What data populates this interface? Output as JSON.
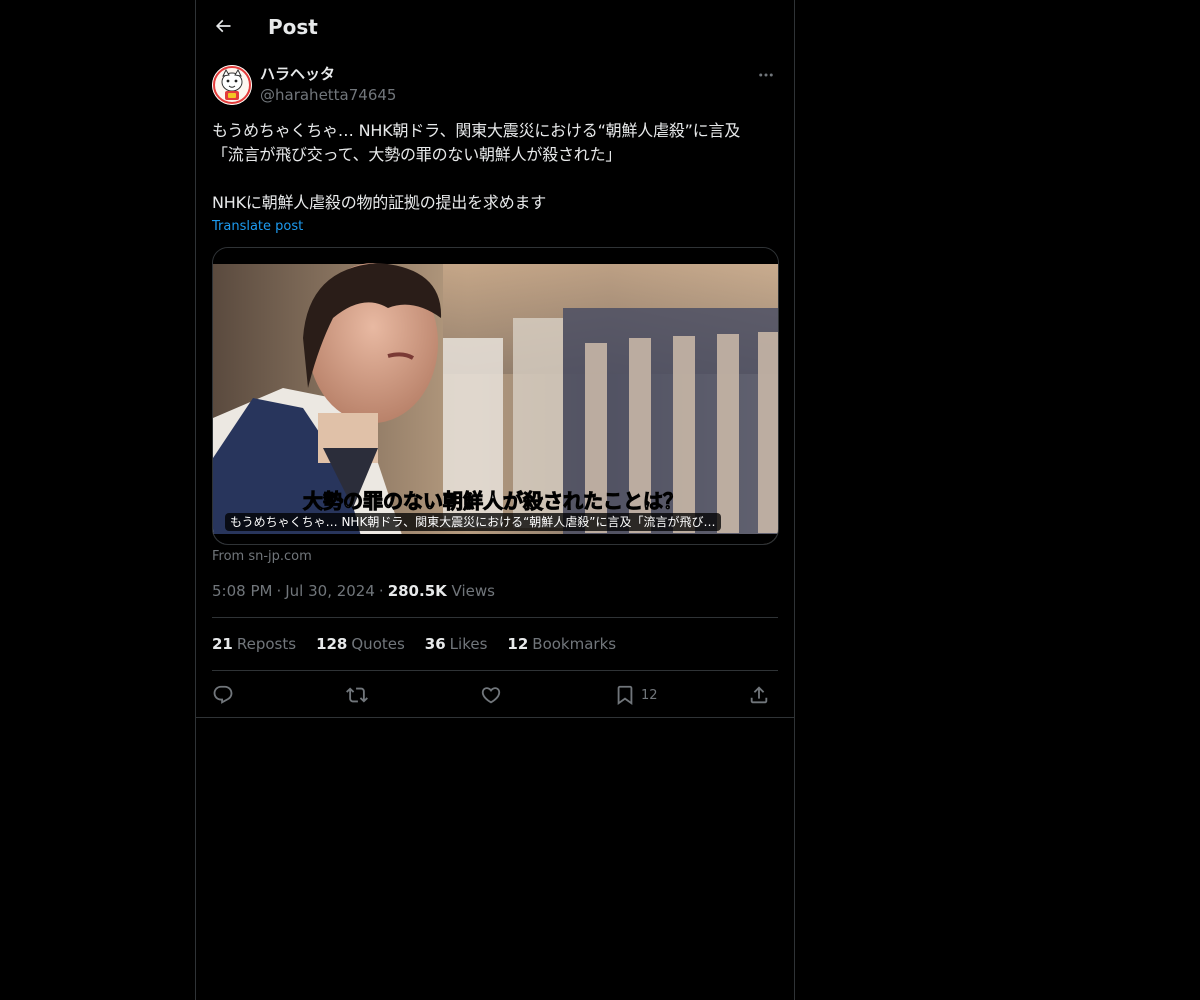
{
  "header": {
    "back_icon": "arrow-left-icon",
    "title": "Post"
  },
  "author": {
    "display_name": "ハラヘッタ",
    "handle": "@harahetta74645",
    "avatar_icon": "cartoon-avatar",
    "more_icon": "more-horizontal-icon"
  },
  "post": {
    "text": "もうめちゃくちゃ… NHK朝ドラ、関東大震災における“朝鮮人虐殺”に言及\n「流言が飛び交って、大勢の罪のない朝鮮人が殺された」\n\nNHKに朝鮮人虐殺の物的証拠の提出を求めます",
    "translate_label": "Translate post"
  },
  "card": {
    "image_subtitle": "大勢の罪のない朝鮮人が殺されたことは？",
    "caption": "もうめちゃくちゃ… NHK朝ドラ、関東大震災における“朝鮮人虐殺”に言及「流言が飛び…",
    "source": "From sn-jp.com"
  },
  "meta": {
    "time": "5:08 PM",
    "date": "Jul 30, 2024",
    "views_count": "280.5K",
    "views_label": "Views"
  },
  "stats": [
    {
      "count": "21",
      "label": "Reposts"
    },
    {
      "count": "128",
      "label": "Quotes"
    },
    {
      "count": "36",
      "label": "Likes"
    },
    {
      "count": "12",
      "label": "Bookmarks"
    }
  ],
  "actions": {
    "reply_icon": "reply-icon",
    "repost_icon": "repost-icon",
    "like_icon": "heart-icon",
    "bookmark_icon": "bookmark-icon",
    "bookmark_count": "12",
    "share_icon": "share-icon"
  },
  "colors": {
    "background": "#000000",
    "text_primary": "#e7e9ea",
    "text_secondary": "#71767b",
    "accent": "#1d9bf0",
    "border": "#2f3336"
  }
}
